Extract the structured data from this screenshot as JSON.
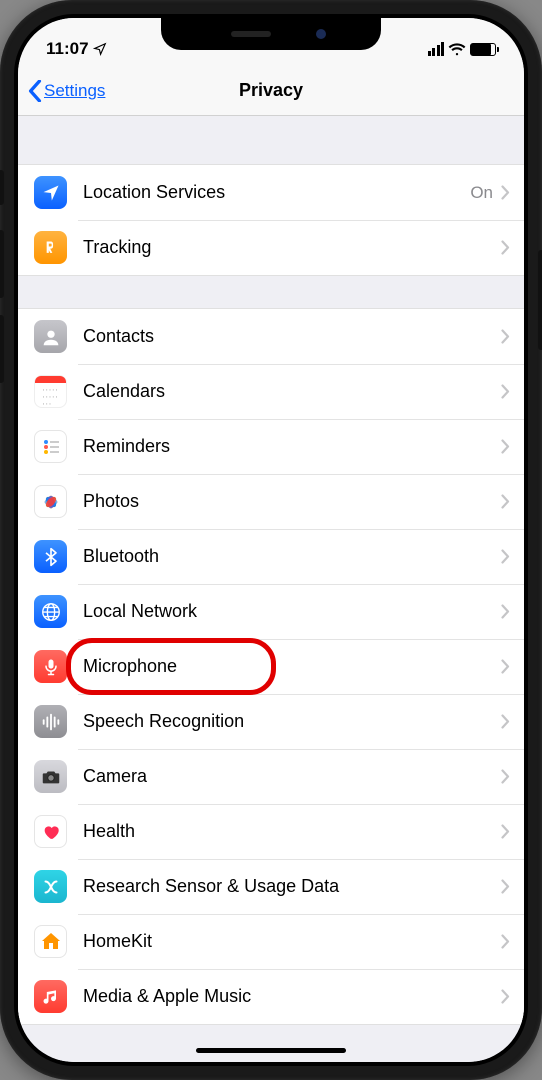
{
  "statusBar": {
    "time": "11:07"
  },
  "nav": {
    "back": "Settings",
    "title": "Privacy"
  },
  "group1": [
    {
      "key": "location",
      "label": "Location Services",
      "detail": "On"
    },
    {
      "key": "tracking",
      "label": "Tracking"
    }
  ],
  "group2": [
    {
      "key": "contacts",
      "label": "Contacts"
    },
    {
      "key": "calendars",
      "label": "Calendars"
    },
    {
      "key": "reminders",
      "label": "Reminders"
    },
    {
      "key": "photos",
      "label": "Photos"
    },
    {
      "key": "bluetooth",
      "label": "Bluetooth"
    },
    {
      "key": "localnet",
      "label": "Local Network"
    },
    {
      "key": "microphone",
      "label": "Microphone",
      "highlight": true
    },
    {
      "key": "speech",
      "label": "Speech Recognition"
    },
    {
      "key": "camera",
      "label": "Camera"
    },
    {
      "key": "health",
      "label": "Health"
    },
    {
      "key": "research",
      "label": "Research Sensor & Usage Data"
    },
    {
      "key": "homekit",
      "label": "HomeKit"
    },
    {
      "key": "media",
      "label": "Media & Apple Music"
    }
  ]
}
